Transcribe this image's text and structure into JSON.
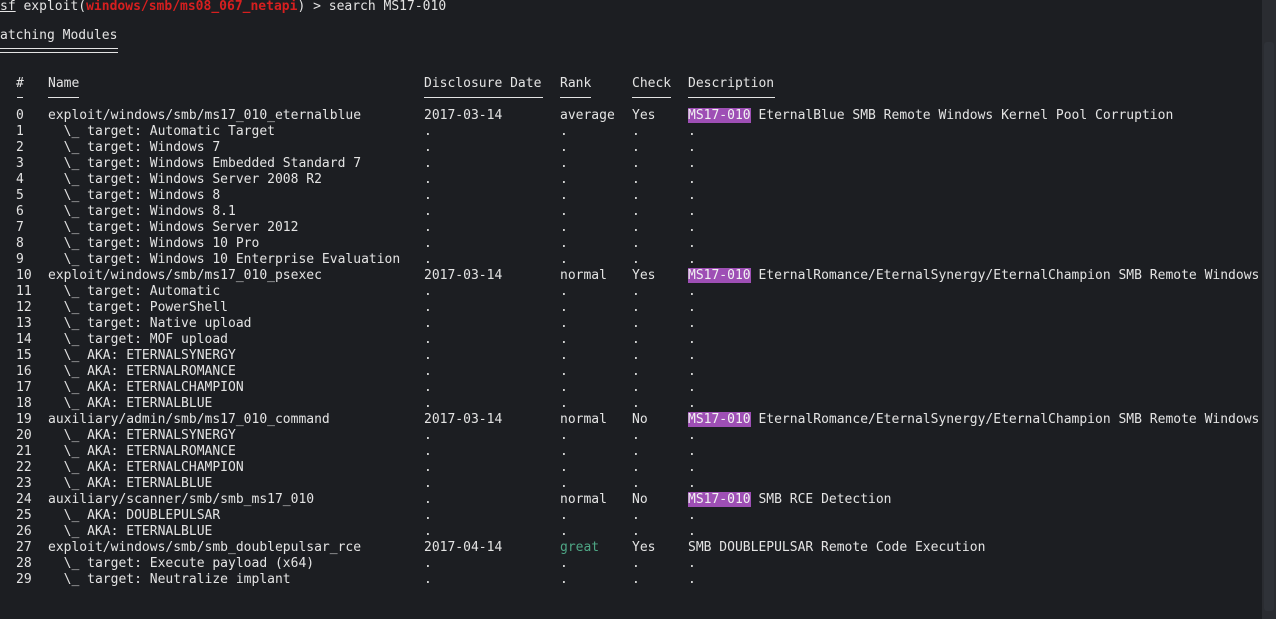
{
  "prompt": {
    "msf": "sf",
    "before": " exploit(",
    "module": "windows/smb/ms08_067_netapi",
    "after": ") > search MS17-010"
  },
  "heading": "atching Modules",
  "columns": {
    "num": "#",
    "name": "Name",
    "date": "Disclosure Date",
    "rank": "Rank",
    "check": "Check",
    "description": "Description"
  },
  "rows": [
    {
      "num": "0",
      "name": "exploit/windows/smb/ms17_010_eternalblue",
      "date": "2017-03-14",
      "rank": "average",
      "check": "Yes",
      "hl": "MS17-010",
      "desc": " EternalBlue SMB Remote Windows Kernel Pool Corruption"
    },
    {
      "num": "1",
      "name": "  \\_ target: Automatic Target",
      "date": ".",
      "rank": ".",
      "check": ".",
      "hl": "",
      "desc": "."
    },
    {
      "num": "2",
      "name": "  \\_ target: Windows 7",
      "date": ".",
      "rank": ".",
      "check": ".",
      "hl": "",
      "desc": "."
    },
    {
      "num": "3",
      "name": "  \\_ target: Windows Embedded Standard 7",
      "date": ".",
      "rank": ".",
      "check": ".",
      "hl": "",
      "desc": "."
    },
    {
      "num": "4",
      "name": "  \\_ target: Windows Server 2008 R2",
      "date": ".",
      "rank": ".",
      "check": ".",
      "hl": "",
      "desc": "."
    },
    {
      "num": "5",
      "name": "  \\_ target: Windows 8",
      "date": ".",
      "rank": ".",
      "check": ".",
      "hl": "",
      "desc": "."
    },
    {
      "num": "6",
      "name": "  \\_ target: Windows 8.1",
      "date": ".",
      "rank": ".",
      "check": ".",
      "hl": "",
      "desc": "."
    },
    {
      "num": "7",
      "name": "  \\_ target: Windows Server 2012",
      "date": ".",
      "rank": ".",
      "check": ".",
      "hl": "",
      "desc": "."
    },
    {
      "num": "8",
      "name": "  \\_ target: Windows 10 Pro",
      "date": ".",
      "rank": ".",
      "check": ".",
      "hl": "",
      "desc": "."
    },
    {
      "num": "9",
      "name": "  \\_ target: Windows 10 Enterprise Evaluation",
      "date": ".",
      "rank": ".",
      "check": ".",
      "hl": "",
      "desc": "."
    },
    {
      "num": "10",
      "name": "exploit/windows/smb/ms17_010_psexec",
      "date": "2017-03-14",
      "rank": "normal",
      "check": "Yes",
      "hl": "MS17-010",
      "desc": " EternalRomance/EternalSynergy/EternalChampion SMB Remote Windows"
    },
    {
      "num": "11",
      "name": "  \\_ target: Automatic",
      "date": ".",
      "rank": ".",
      "check": ".",
      "hl": "",
      "desc": "."
    },
    {
      "num": "12",
      "name": "  \\_ target: PowerShell",
      "date": ".",
      "rank": ".",
      "check": ".",
      "hl": "",
      "desc": "."
    },
    {
      "num": "13",
      "name": "  \\_ target: Native upload",
      "date": ".",
      "rank": ".",
      "check": ".",
      "hl": "",
      "desc": "."
    },
    {
      "num": "14",
      "name": "  \\_ target: MOF upload",
      "date": ".",
      "rank": ".",
      "check": ".",
      "hl": "",
      "desc": "."
    },
    {
      "num": "15",
      "name": "  \\_ AKA: ETERNALSYNERGY",
      "date": ".",
      "rank": ".",
      "check": ".",
      "hl": "",
      "desc": "."
    },
    {
      "num": "16",
      "name": "  \\_ AKA: ETERNALROMANCE",
      "date": ".",
      "rank": ".",
      "check": ".",
      "hl": "",
      "desc": "."
    },
    {
      "num": "17",
      "name": "  \\_ AKA: ETERNALCHAMPION",
      "date": ".",
      "rank": ".",
      "check": ".",
      "hl": "",
      "desc": "."
    },
    {
      "num": "18",
      "name": "  \\_ AKA: ETERNALBLUE",
      "date": ".",
      "rank": ".",
      "check": ".",
      "hl": "",
      "desc": "."
    },
    {
      "num": "19",
      "name": "auxiliary/admin/smb/ms17_010_command",
      "date": "2017-03-14",
      "rank": "normal",
      "check": "No",
      "hl": "MS17-010",
      "desc": " EternalRomance/EternalSynergy/EternalChampion SMB Remote Windows"
    },
    {
      "num": "20",
      "name": "  \\_ AKA: ETERNALSYNERGY",
      "date": ".",
      "rank": ".",
      "check": ".",
      "hl": "",
      "desc": "."
    },
    {
      "num": "21",
      "name": "  \\_ AKA: ETERNALROMANCE",
      "date": ".",
      "rank": ".",
      "check": ".",
      "hl": "",
      "desc": "."
    },
    {
      "num": "22",
      "name": "  \\_ AKA: ETERNALCHAMPION",
      "date": ".",
      "rank": ".",
      "check": ".",
      "hl": "",
      "desc": "."
    },
    {
      "num": "23",
      "name": "  \\_ AKA: ETERNALBLUE",
      "date": ".",
      "rank": ".",
      "check": ".",
      "hl": "",
      "desc": "."
    },
    {
      "num": "24",
      "name": "auxiliary/scanner/smb/smb_ms17_010",
      "date": ".",
      "rank": "normal",
      "check": "No",
      "hl": "MS17-010",
      "desc": " SMB RCE Detection"
    },
    {
      "num": "25",
      "name": "  \\_ AKA: DOUBLEPULSAR",
      "date": ".",
      "rank": ".",
      "check": ".",
      "hl": "",
      "desc": "."
    },
    {
      "num": "26",
      "name": "  \\_ AKA: ETERNALBLUE",
      "date": ".",
      "rank": ".",
      "check": ".",
      "hl": "",
      "desc": "."
    },
    {
      "num": "27",
      "name": "exploit/windows/smb/smb_doublepulsar_rce",
      "date": "2017-04-14",
      "rank": "great",
      "check": "Yes",
      "hl": "",
      "desc": "SMB DOUBLEPULSAR Remote Code Execution"
    },
    {
      "num": "28",
      "name": "  \\_ target: Execute payload (x64)",
      "date": ".",
      "rank": ".",
      "check": ".",
      "hl": "",
      "desc": "."
    },
    {
      "num": "29",
      "name": "  \\_ target: Neutralize implant",
      "date": ".",
      "rank": ".",
      "check": ".",
      "hl": "",
      "desc": "."
    }
  ],
  "colors": {
    "background": "#1c1e22",
    "text": "#e4e4e4",
    "module": "#d61f1f",
    "highlight": "#9e4fb5",
    "great": "#4ea685"
  }
}
